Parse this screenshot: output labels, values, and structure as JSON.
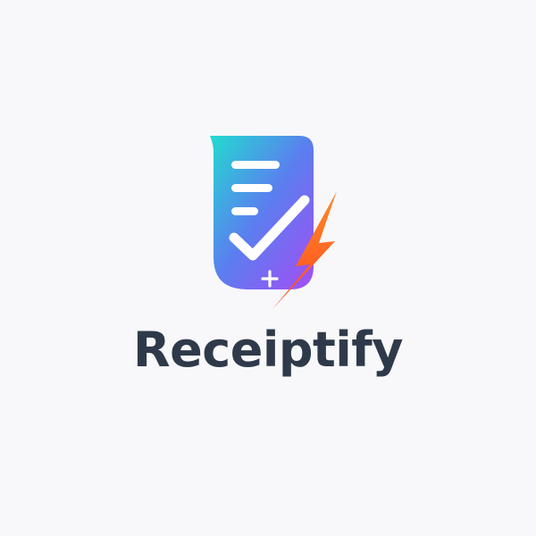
{
  "brand": {
    "name": "Receiptify",
    "colors": {
      "background": "#f8f8fa",
      "wordmark": "#2e3a4a",
      "gradient_start": "#22dcd0",
      "gradient_mid": "#5b7ef0",
      "gradient_end": "#a44df5",
      "bolt_start": "#ff8a2a",
      "bolt_end": "#ff4a1c"
    },
    "icons": [
      "receipt-icon",
      "checkmark-icon",
      "lightning-bolt-icon",
      "sparkle-plus-icon"
    ]
  }
}
